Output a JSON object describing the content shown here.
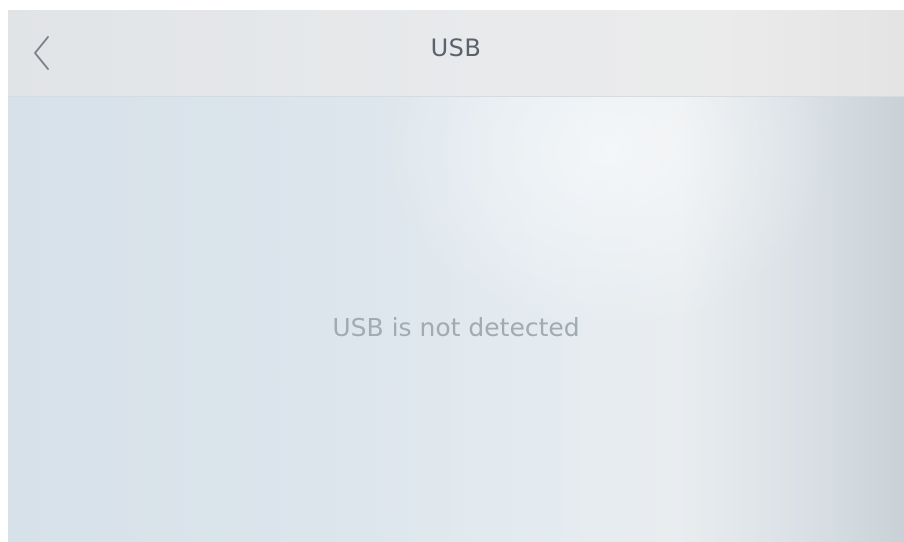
{
  "header": {
    "title": "USB",
    "back_icon": "chevron-left-icon"
  },
  "main": {
    "status_message": "USB is not detected"
  },
  "colors": {
    "title_text": "#5b626b",
    "message_text": "#a2abb4",
    "back_icon": "#7a8088"
  }
}
